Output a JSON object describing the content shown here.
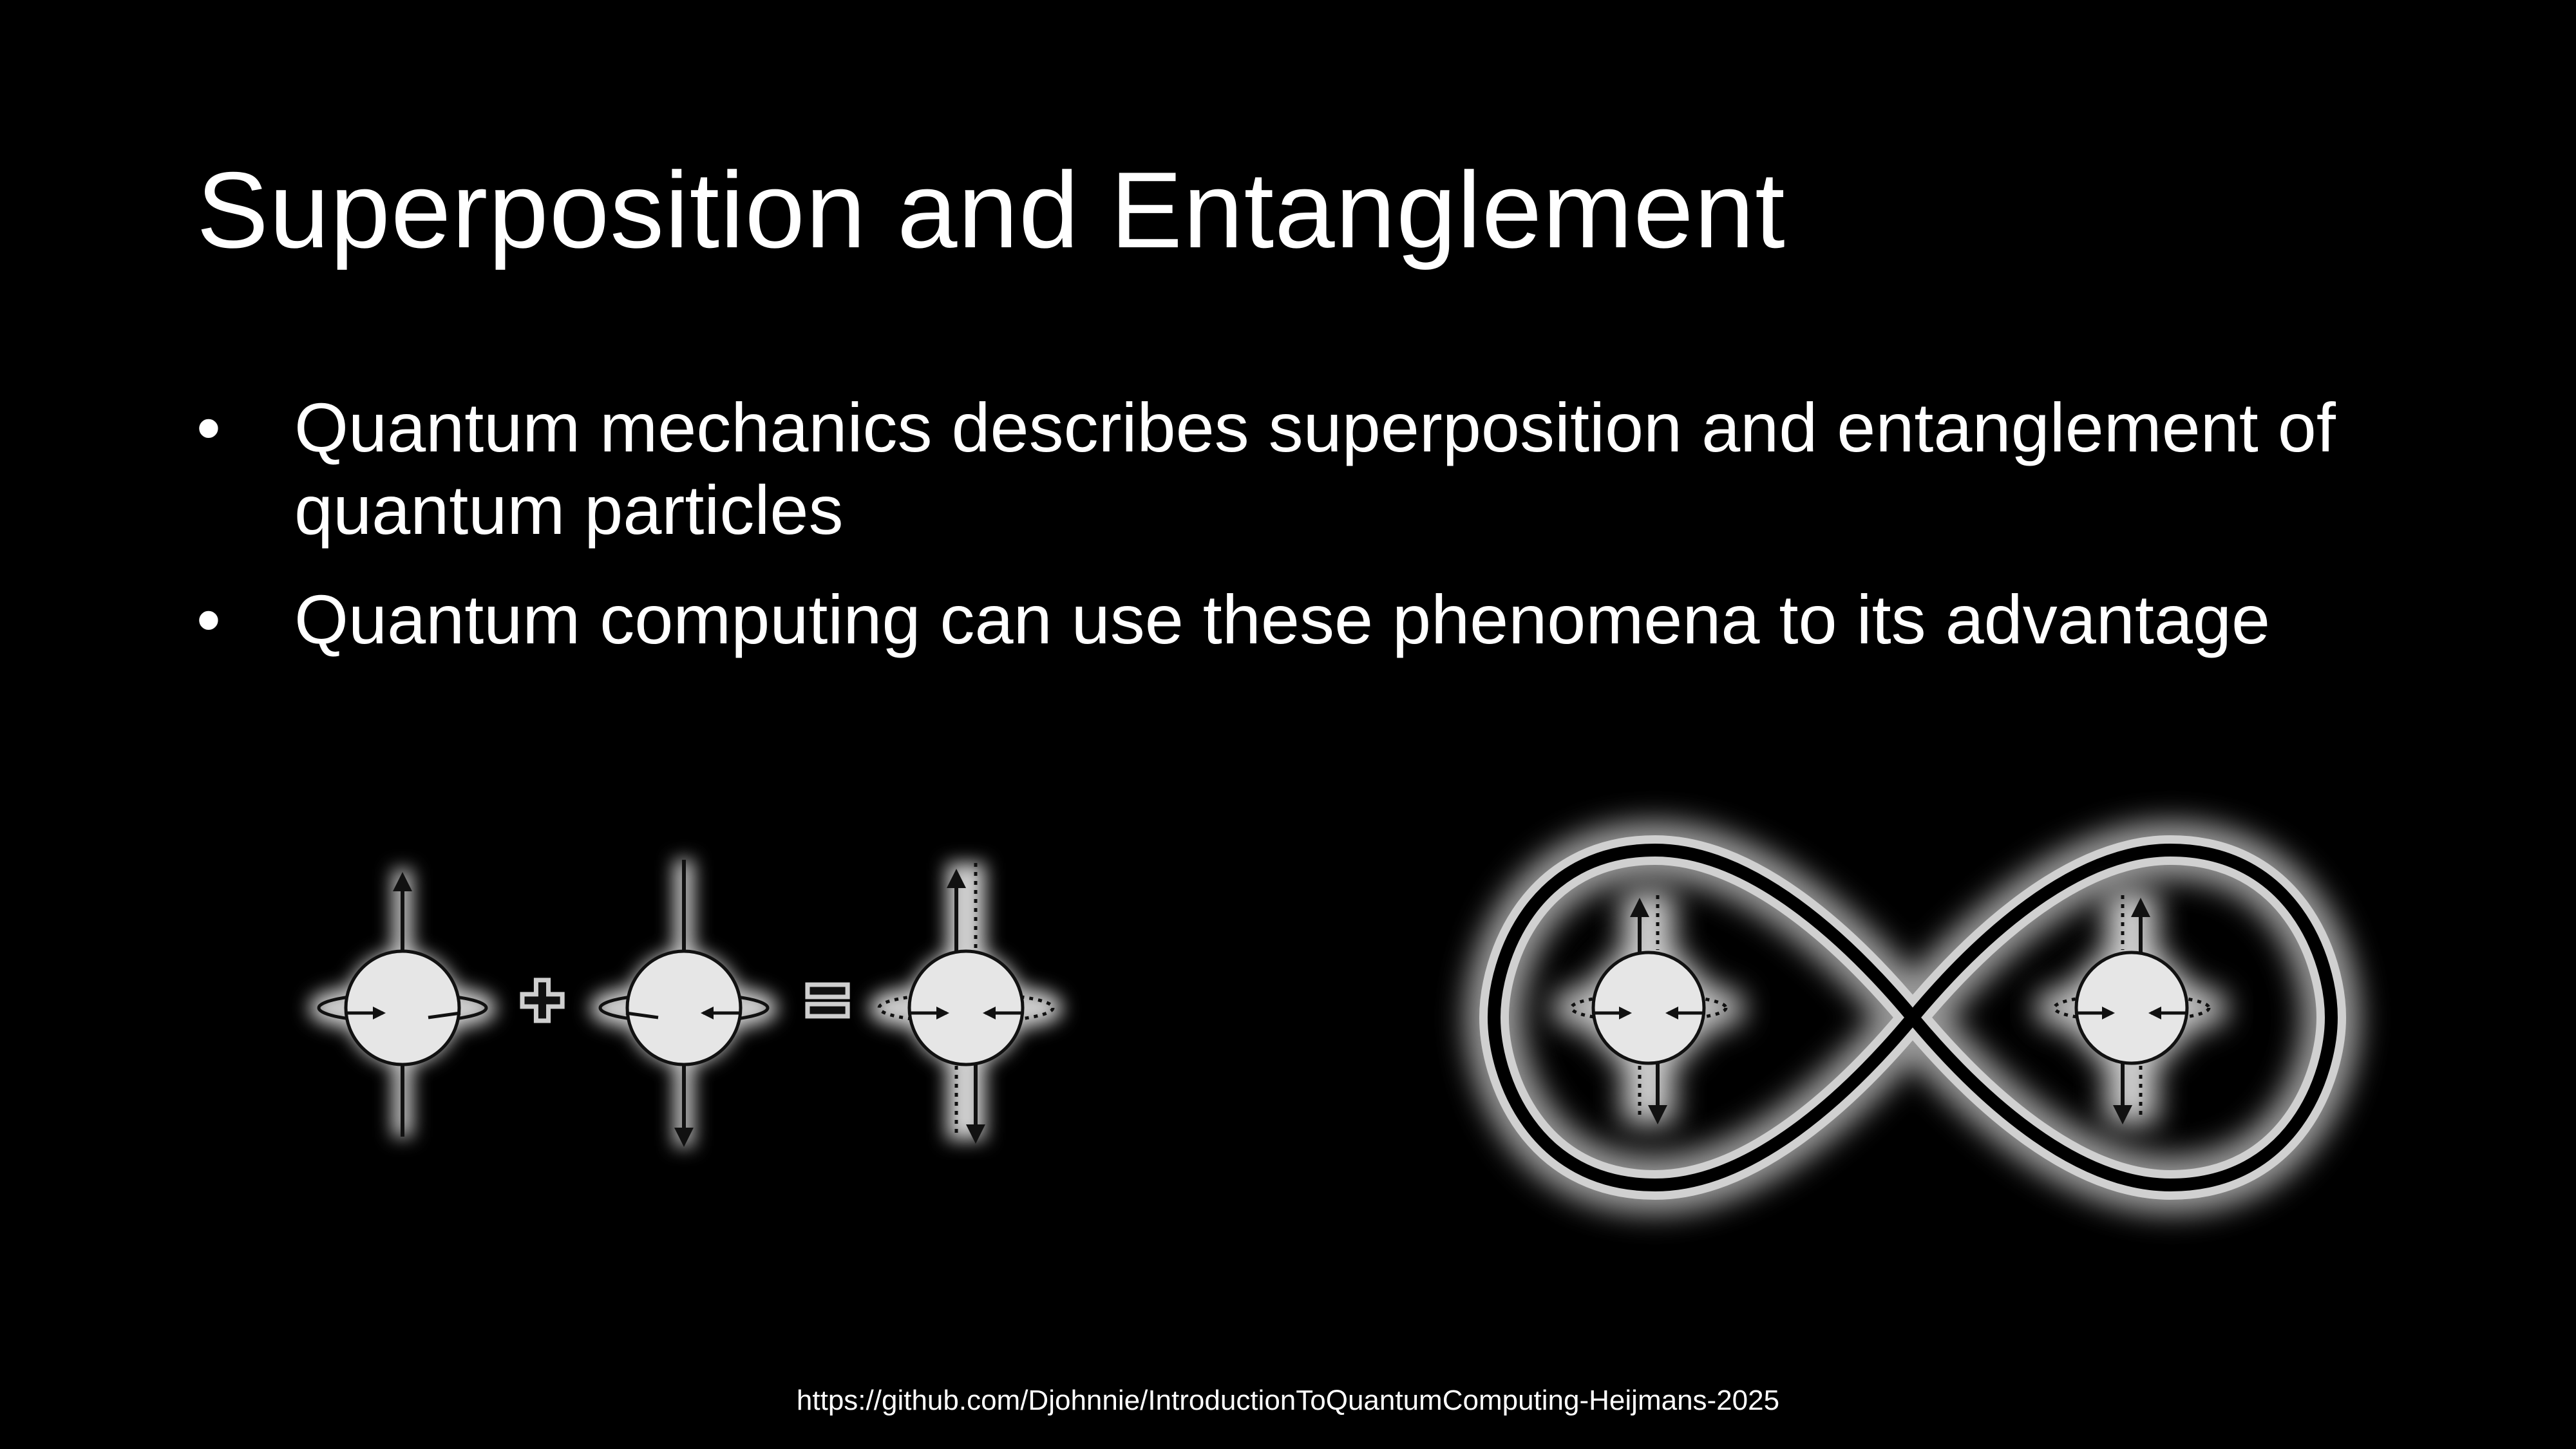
{
  "slide": {
    "title": "Superposition and Entanglement",
    "bullets": [
      "Quantum mechanics describes superposition and entanglement of quantum particles",
      "Quantum computing can use these phenomena to its advantage"
    ],
    "bullet_symbol": "•",
    "footer": "https://github.com/Djohnnie/IntroductionToQuantumComputing-Heijmans-2025"
  },
  "diagrams": {
    "superposition": {
      "plus_sign": "+",
      "equals_sign": "=",
      "icons": [
        "spin-up-particle-icon",
        "spin-down-particle-icon",
        "superposition-particle-icon"
      ]
    },
    "entanglement": {
      "icons": [
        "infinity-loop-icon",
        "entangled-particle-icon",
        "entangled-particle-icon"
      ]
    }
  },
  "colors": {
    "background": "#000000",
    "text": "#ffffff",
    "particle_fill": "#e6e6e6",
    "glow": "#d9d9d9",
    "stroke": "#111111"
  }
}
